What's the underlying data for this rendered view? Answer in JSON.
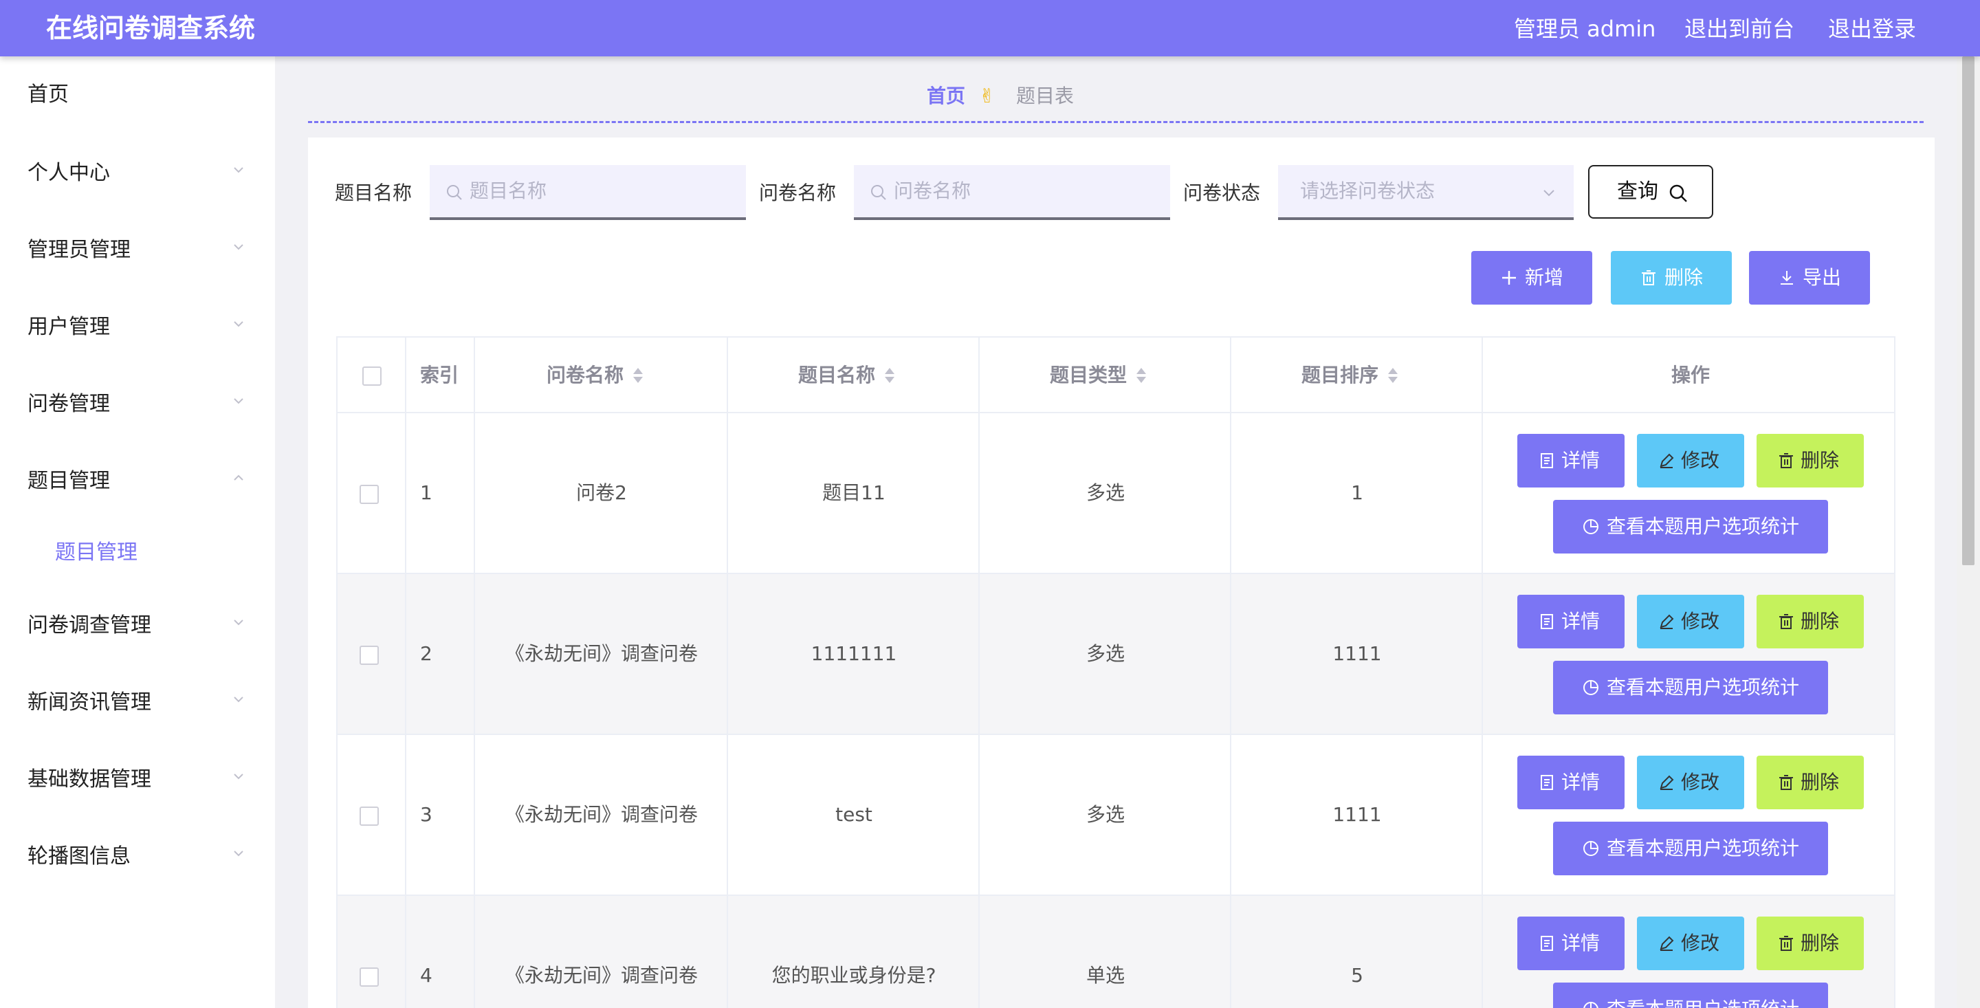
{
  "header": {
    "title": "在线问卷调查系统",
    "user_label": "管理员 admin",
    "to_front_label": "退出到前台",
    "logout_label": "退出登录"
  },
  "sidebar": {
    "items": [
      {
        "label": "首页"
      },
      {
        "label": "个人中心"
      },
      {
        "label": "管理员管理"
      },
      {
        "label": "用户管理"
      },
      {
        "label": "问卷管理"
      },
      {
        "label": "题目管理"
      },
      {
        "label": "问卷调查管理"
      },
      {
        "label": "新闻资讯管理"
      },
      {
        "label": "基础数据管理"
      },
      {
        "label": "轮播图信息"
      }
    ],
    "submenu": {
      "label": "题目管理"
    }
  },
  "breadcrumb": {
    "home": "首页",
    "separator": "✌",
    "current": "题目表"
  },
  "search": {
    "question_name_label": "题目名称",
    "question_name_placeholder": "题目名称",
    "survey_name_label": "问卷名称",
    "survey_name_placeholder": "问卷名称",
    "survey_status_label": "问卷状态",
    "survey_status_placeholder": "请选择问卷状态",
    "query_label": "查询"
  },
  "actions": {
    "add_label": "新增",
    "delete_label": "删除",
    "export_label": "导出"
  },
  "table": {
    "headers": {
      "index": "索引",
      "survey_name": "问卷名称",
      "question_name": "题目名称",
      "question_type": "题目类型",
      "question_order": "题目排序",
      "operations": "操作"
    },
    "rows": [
      {
        "index": "1",
        "survey_name": "问卷2",
        "question_name": "题目11",
        "question_type": "多选",
        "question_order": "1"
      },
      {
        "index": "2",
        "survey_name": "《永劫无间》调查问卷",
        "question_name": "1111111",
        "question_type": "多选",
        "question_order": "1111"
      },
      {
        "index": "3",
        "survey_name": "《永劫无间》调查问卷",
        "question_name": "test",
        "question_type": "多选",
        "question_order": "1111"
      },
      {
        "index": "4",
        "survey_name": "《永劫无间》调查问卷",
        "question_name": "您的职业或身份是?",
        "question_type": "单选",
        "question_order": "5"
      }
    ],
    "row_buttons": {
      "detail_label": "详情",
      "edit_label": "修改",
      "delete_label": "删除",
      "stats_label": "查看本题用户选项统计"
    }
  },
  "colors": {
    "primary": "#7b75f4",
    "info": "#5dc8f7",
    "danger_lime": "#c5f25c",
    "header_bg": "#7b75f4"
  },
  "icons": {
    "search": "search-icon",
    "chevron": "chevron-down-icon",
    "plus": "plus-icon",
    "trash": "trash-icon",
    "download": "download-icon",
    "doc": "document-icon",
    "edit": "edit-icon",
    "pie": "pie-chart-icon",
    "sort": "sort-icon"
  }
}
